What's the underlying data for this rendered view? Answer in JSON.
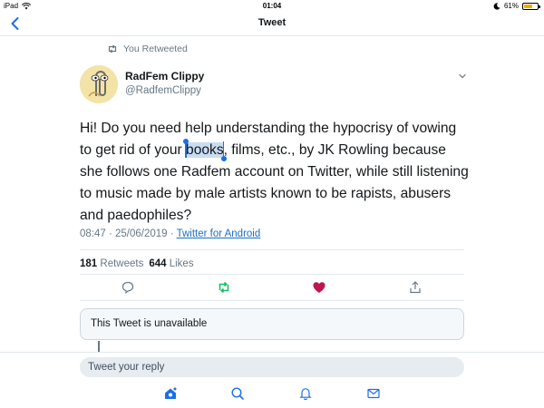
{
  "status_bar": {
    "device": "iPad",
    "time": "01:04",
    "battery_percent": "61%",
    "battery_level": 0.61
  },
  "nav": {
    "title": "Tweet",
    "back_icon": "chevron-left-icon"
  },
  "retweet_context": {
    "label": "You Retweeted"
  },
  "tweet": {
    "author_name": "RadFem Clippy",
    "author_handle": "@RadfemClippy",
    "text_before_selection": "Hi! Do you need help understanding the hypocrisy of vowing to get rid of your ",
    "selected_text": "books",
    "text_after_selection": ", films, etc., by JK Rowling because she follows one Radfem account on Twitter, while still listening to music made by male artists known to be rapists, abusers and paedophiles?",
    "timestamp": "08:47 · 25/06/2019 · ",
    "source": "Twitter for Android",
    "retweet_count": "181",
    "retweet_label": "Retweets",
    "like_count": "644",
    "like_label": "Likes",
    "retweeted": true,
    "liked": true
  },
  "quoted_tweet": {
    "unavailable_text": "This Tweet is unavailable"
  },
  "reply": {
    "placeholder": "Tweet your reply"
  },
  "tab_bar": {
    "items": [
      "home-icon",
      "search-icon",
      "notifications-icon",
      "messages-icon"
    ]
  },
  "colors": {
    "accent": "#1da1f2",
    "retweet_green": "#17bf63",
    "like_red": "#c0154f",
    "selection": "#c9ddf2",
    "link": "#1b6fc2"
  }
}
